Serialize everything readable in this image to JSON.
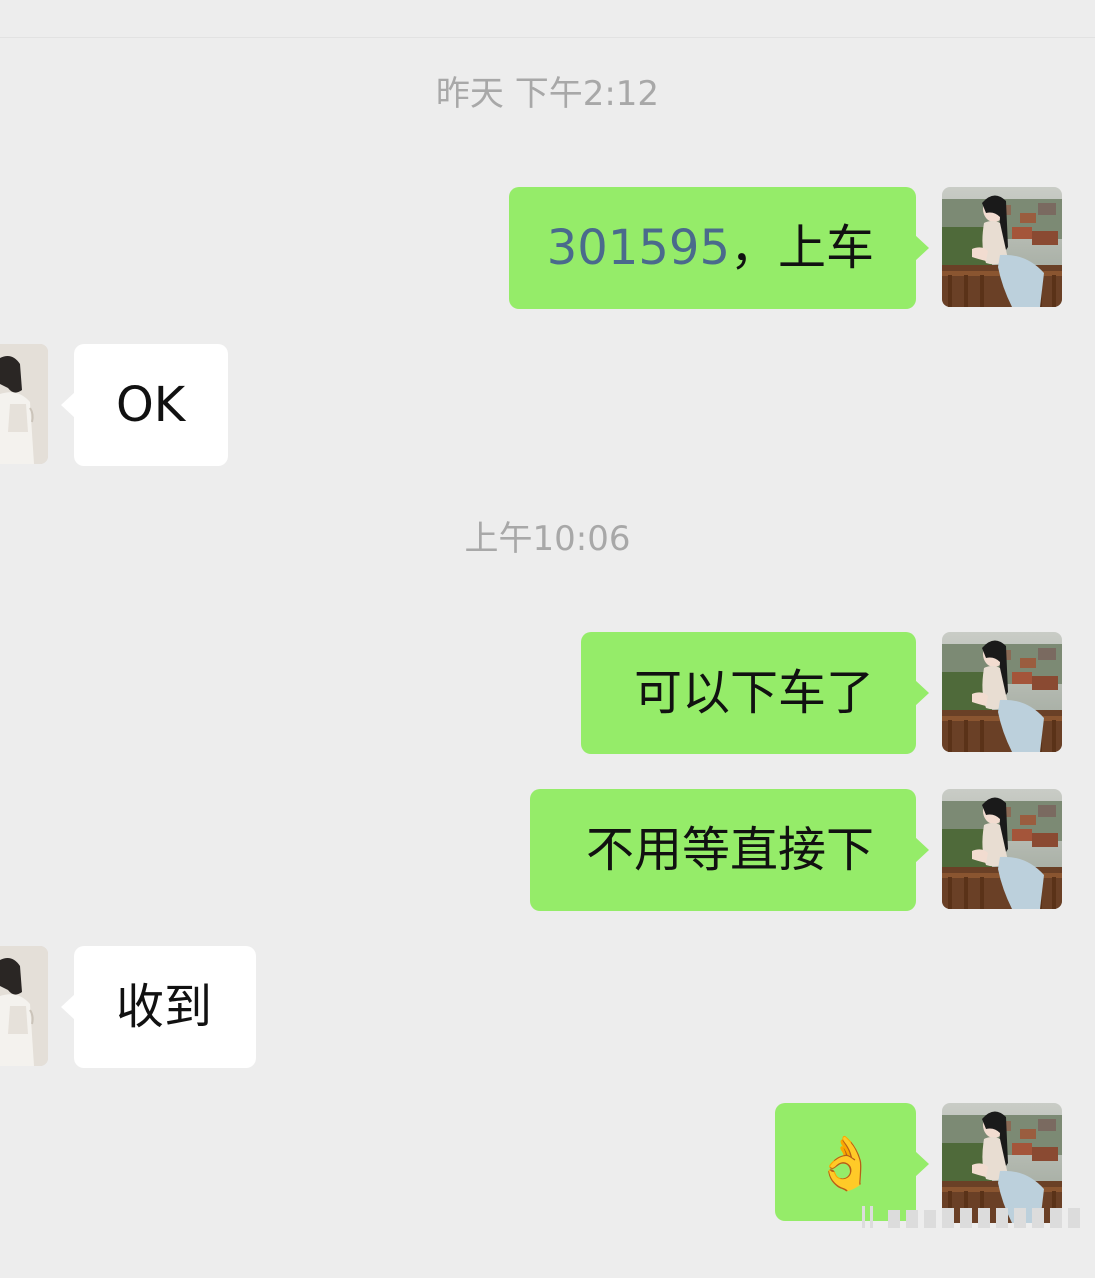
{
  "chat": {
    "timestamps": [
      "昨天 下午2:12",
      "上午10:06"
    ],
    "messages": [
      {
        "sender": "me",
        "number": "301595",
        "text": "，上车"
      },
      {
        "sender": "contact",
        "text": "OK"
      },
      {
        "sender": "me",
        "text": "可以下车了"
      },
      {
        "sender": "me",
        "text": "不用等直接下"
      },
      {
        "sender": "contact",
        "text": "收到"
      },
      {
        "sender": "me",
        "emoji": "👌"
      }
    ]
  },
  "colors": {
    "background": "#ededed",
    "outgoing_bubble": "#95ec69",
    "incoming_bubble": "#ffffff",
    "timestamp_text": "#a8a8a8",
    "number_link": "#4a6a8c"
  },
  "icons": {
    "my_avatar": "user-photo-avatar",
    "contact_avatar": "contact-photo-avatar",
    "ok_emoji": "ok-hand-emoji"
  }
}
